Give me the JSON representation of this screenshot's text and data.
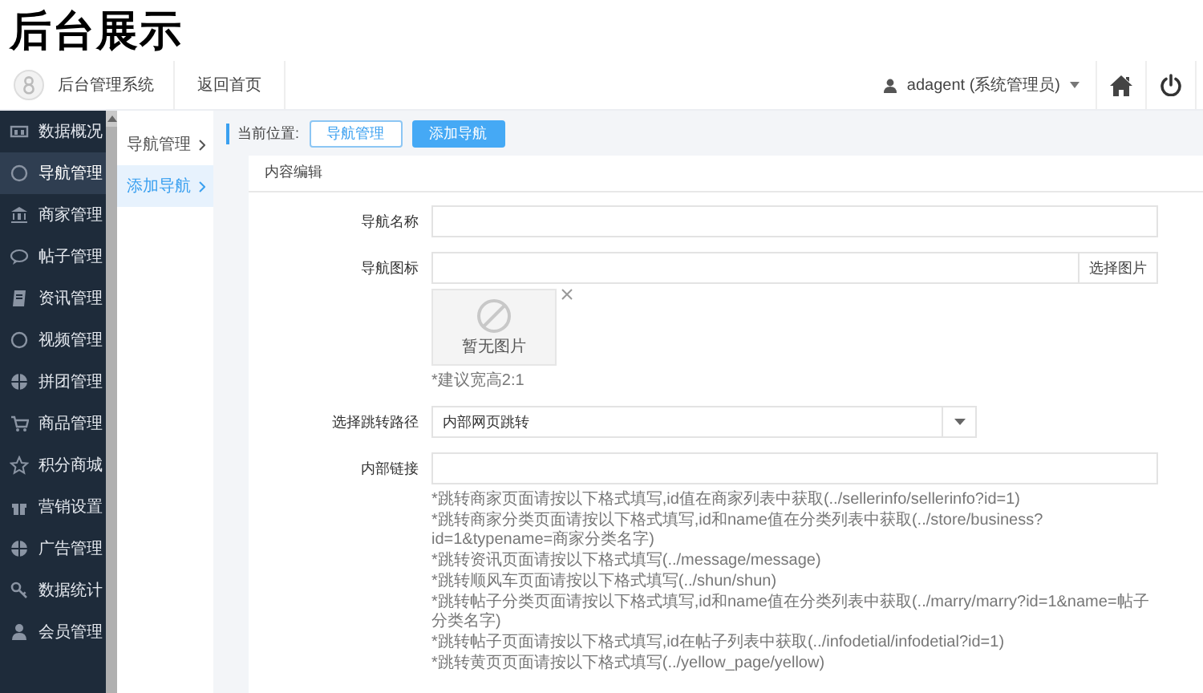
{
  "banner": {
    "title": "后台展示"
  },
  "header": {
    "app_name": "后台管理系统",
    "home_link": "返回首页",
    "user": "adagent (系统管理员)"
  },
  "sidebar": {
    "items": [
      {
        "label": "数据概况",
        "kind": "chart",
        "selected": false
      },
      {
        "label": "导航管理",
        "kind": "compass",
        "selected": true
      },
      {
        "label": "商家管理",
        "kind": "bank",
        "selected": false
      },
      {
        "label": "帖子管理",
        "kind": "chat",
        "selected": false
      },
      {
        "label": "资讯管理",
        "kind": "doc",
        "selected": false
      },
      {
        "label": "视频管理",
        "kind": "compass",
        "selected": false
      },
      {
        "label": "拼团管理",
        "kind": "globe",
        "selected": false
      },
      {
        "label": "商品管理",
        "kind": "cart",
        "selected": false
      },
      {
        "label": "积分商城",
        "kind": "star",
        "selected": false
      },
      {
        "label": "营销设置",
        "kind": "gift",
        "selected": false
      },
      {
        "label": "广告管理",
        "kind": "globe",
        "selected": false
      },
      {
        "label": "数据统计",
        "kind": "key",
        "selected": false
      },
      {
        "label": "会员管理",
        "kind": "person",
        "selected": false
      }
    ]
  },
  "subnav": {
    "items": [
      {
        "label": "导航管理",
        "selected": false
      },
      {
        "label": "添加导航",
        "selected": true
      }
    ]
  },
  "breadcrumb": {
    "label": "当前位置:",
    "items": [
      {
        "label": "导航管理",
        "selected": false
      },
      {
        "label": "添加导航",
        "selected": true
      }
    ]
  },
  "panel": {
    "title": "内容编辑",
    "fields": [
      {
        "kind": "text",
        "label": "导航名称"
      },
      {
        "kind": "image",
        "label": "导航图标",
        "button": "选择图片",
        "preview": "暂无图片",
        "hint": "*建议宽高2:1"
      },
      {
        "kind": "select",
        "label": "选择跳转路径",
        "value": "内部网页跳转"
      },
      {
        "kind": "text",
        "label": "内部链接",
        "hints": [
          "*跳转商家页面请按以下格式填写,id值在商家列表中获取(../sellerinfo/sellerinfo?id=1)",
          "*跳转商家分类页面请按以下格式填写,id和name值在分类列表中获取(../store/business?id=1&typename=商家分类名字)",
          "*跳转资讯页面请按以下格式填写(../message/message)",
          "*跳转顺风车页面请按以下格式填写(../shun/shun)",
          "*跳转帖子分类页面请按以下格式填写,id和name值在分类列表中获取(../marry/marry?id=1&name=帖子分类名字)",
          "*跳转帖子页面请按以下格式填写,id在帖子列表中获取(../infodetial/infodetial?id=1)",
          "*跳转黄页页面请按以下格式填写(../yellow_page/yellow)"
        ]
      }
    ]
  }
}
